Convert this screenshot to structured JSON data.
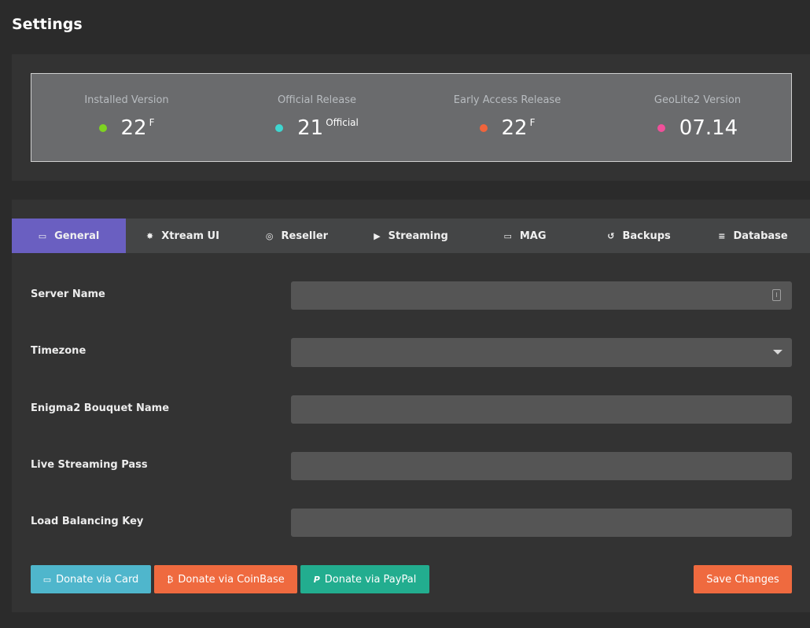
{
  "page": {
    "title": "Settings"
  },
  "versions": [
    {
      "label": "Installed Version",
      "value": "22",
      "sup": "F",
      "dot_color": "#7ed321"
    },
    {
      "label": "Official Release",
      "value": "21",
      "sup": "Official",
      "dot_color": "#3fd6d0"
    },
    {
      "label": "Early Access Release",
      "value": "22",
      "sup": "F",
      "dot_color": "#f0643c"
    },
    {
      "label": "GeoLite2 Version",
      "value": "07.14",
      "sup": "",
      "dot_color": "#f0509a"
    }
  ],
  "tabs": [
    {
      "label": "General",
      "icon": "id-card-icon",
      "glyph": "▭"
    },
    {
      "label": "Xtream UI",
      "icon": "gear-icon",
      "glyph": "✸"
    },
    {
      "label": "Reseller",
      "icon": "coins-icon",
      "glyph": "◎"
    },
    {
      "label": "Streaming",
      "icon": "play-icon",
      "glyph": "▶"
    },
    {
      "label": "MAG",
      "icon": "tv-icon",
      "glyph": "▭"
    },
    {
      "label": "Backups",
      "icon": "history-icon",
      "glyph": "↺"
    },
    {
      "label": "Database",
      "icon": "database-icon",
      "glyph": "≡"
    }
  ],
  "form": {
    "server_name": {
      "label": "Server Name",
      "value": ""
    },
    "timezone": {
      "label": "Timezone",
      "value": ""
    },
    "enigma_bouquet": {
      "label": "Enigma2 Bouquet Name",
      "value": ""
    },
    "live_pass": {
      "label": "Live Streaming Pass",
      "value": ""
    },
    "lb_key": {
      "label": "Load Balancing Key",
      "value": ""
    }
  },
  "buttons": {
    "donate_card": {
      "label": "Donate via Card",
      "glyph": "▭"
    },
    "donate_coinbase": {
      "label": "Donate via CoinBase",
      "glyph": "₿"
    },
    "donate_paypal": {
      "label": "Donate via PayPal",
      "glyph": "P"
    },
    "save": {
      "label": "Save Changes"
    }
  },
  "colors": {
    "tab_active": "#6a5fc1",
    "btn_card": "#4fb6cc",
    "btn_coinbase": "#ef6a3f",
    "btn_paypal": "#22ad8f",
    "btn_save": "#ef6a3f"
  }
}
